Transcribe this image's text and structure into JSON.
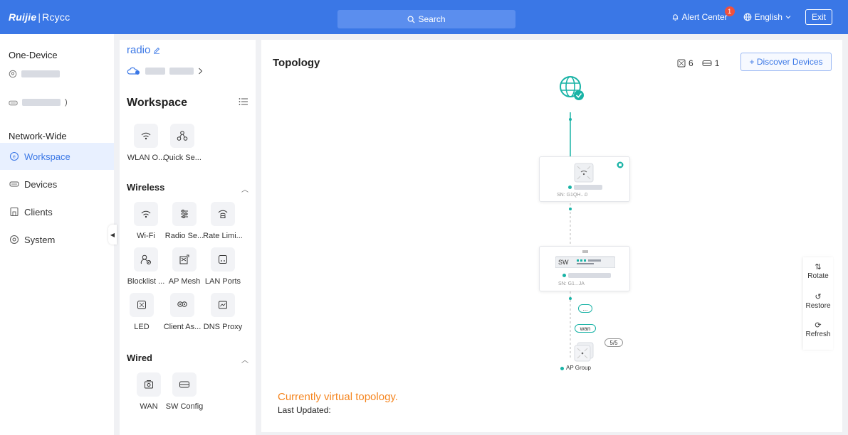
{
  "header": {
    "brand_main": "Ruijie",
    "brand_sep": "|",
    "brand_sub": "Rcycc",
    "search_label": "Search",
    "alert_label": "Alert Center",
    "alert_count": "1",
    "language_label": "English",
    "exit_label": "Exit"
  },
  "leftnav": {
    "one_device_label": "One-Device",
    "network_wide_label": "Network-Wide",
    "items": [
      {
        "label": "Workspace",
        "icon": "workspace-icon"
      },
      {
        "label": "Devices",
        "icon": "devices-icon"
      },
      {
        "label": "Clients",
        "icon": "clients-icon"
      },
      {
        "label": "System",
        "icon": "system-icon"
      }
    ]
  },
  "workspace": {
    "device_name": "radio",
    "title": "Workspace",
    "quick_tiles": [
      {
        "label": "WLAN O...",
        "icon": "wlan-icon"
      },
      {
        "label": "Quick Se...",
        "icon": "quick-setup-icon"
      }
    ],
    "groups": [
      {
        "title": "Wireless",
        "tiles": [
          {
            "label": "Wi-Fi",
            "icon": "wifi-icon"
          },
          {
            "label": "Radio Se...",
            "icon": "radio-settings-icon"
          },
          {
            "label": "Rate Limi...",
            "icon": "rate-limit-icon"
          },
          {
            "label": "Blocklist ...",
            "icon": "blocklist-icon"
          },
          {
            "label": "AP Mesh",
            "icon": "ap-mesh-icon"
          },
          {
            "label": "LAN Ports",
            "icon": "lan-ports-icon"
          },
          {
            "label": "LED",
            "icon": "led-icon"
          },
          {
            "label": "Client As...",
            "icon": "client-assoc-icon"
          },
          {
            "label": "DNS Proxy",
            "icon": "dns-proxy-icon"
          }
        ]
      },
      {
        "title": "Wired",
        "tiles": [
          {
            "label": "WAN",
            "icon": "wan-icon"
          },
          {
            "label": "SW Config",
            "icon": "sw-config-icon"
          }
        ]
      }
    ]
  },
  "topology": {
    "title": "Topology",
    "ap_count": "6",
    "switch_count": "1",
    "discover_label": "+ Discover Devices",
    "ap_sn": "SN: G1QH...0",
    "sw_label": "SW",
    "sw_sn": "SN: G1...JA",
    "ellipsis_pill": "...",
    "wan_pill": "wan",
    "group_count": "5/5",
    "ap_group_label": "AP Group",
    "virtual_note": "Currently virtual topology.",
    "last_updated_label": "Last Updated:"
  },
  "tools": {
    "rotate": "Rotate",
    "restore": "Restore",
    "refresh": "Refresh"
  },
  "colors": {
    "header_bg": "#3a77e6",
    "accent": "#3a77e6",
    "online": "#19b3a6",
    "warning_text": "#f5851f",
    "alert_badge": "#f0503c"
  }
}
